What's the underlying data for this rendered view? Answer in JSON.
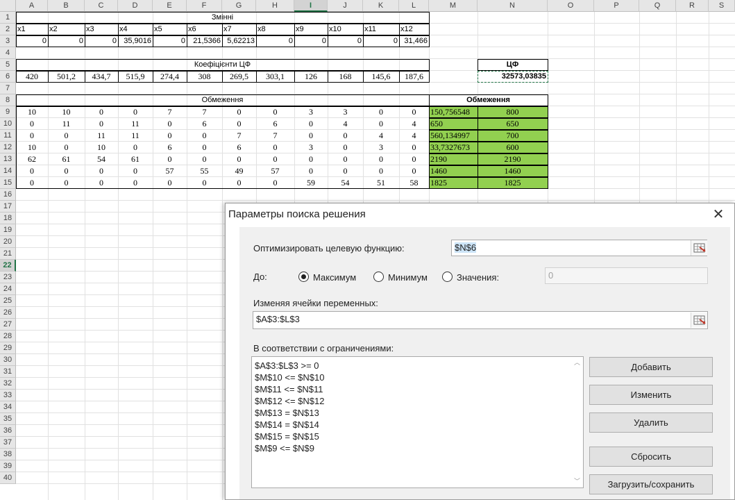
{
  "sheet": {
    "columns": [
      "A",
      "B",
      "C",
      "D",
      "E",
      "F",
      "G",
      "H",
      "I",
      "J",
      "K",
      "L",
      "M",
      "N",
      "O",
      "P",
      "Q",
      "R",
      "S"
    ],
    "rows": [
      "1",
      "2",
      "3",
      "4",
      "5",
      "6",
      "7",
      "8",
      "9",
      "10",
      "11",
      "12",
      "13",
      "14",
      "15",
      "16",
      "17",
      "18",
      "19",
      "20",
      "21",
      "22",
      "23",
      "24",
      "25",
      "26",
      "27",
      "28",
      "29",
      "30",
      "31",
      "32",
      "33",
      "34",
      "35",
      "36",
      "37",
      "38",
      "39",
      "40"
    ],
    "selected_column": "I",
    "selected_row": "22",
    "variables_title": "Змінні",
    "var_names": [
      "x1",
      "x2",
      "x3",
      "x4",
      "x5",
      "x6",
      "x7",
      "x8",
      "x9",
      "x10",
      "x11",
      "x12"
    ],
    "var_values": [
      "0",
      "0",
      "0",
      "35,9016",
      "0",
      "21,5366",
      "5,62213",
      "0",
      "0",
      "0",
      "0",
      "31,466"
    ],
    "coef_title": "Коефіцієнти ЦФ",
    "coef_values": [
      "420",
      "501,2",
      "434,7",
      "515,9",
      "274,4",
      "308",
      "269,5",
      "303,1",
      "126",
      "168",
      "145,6",
      "187,6"
    ],
    "cf_title": "ЦФ",
    "cf_value": "32573,03835",
    "constraints_title": "Обмеження",
    "constraints_title2": "Обмеження",
    "constraint_rows": [
      {
        "coefs": [
          "10",
          "10",
          "0",
          "0",
          "7",
          "7",
          "0",
          "0",
          "3",
          "3",
          "0",
          "0"
        ],
        "lhs": "150,756548",
        "rhs": "800"
      },
      {
        "coefs": [
          "0",
          "11",
          "0",
          "11",
          "0",
          "6",
          "0",
          "6",
          "0",
          "4",
          "0",
          "4"
        ],
        "lhs": "650",
        "rhs": "650"
      },
      {
        "coefs": [
          "0",
          "0",
          "11",
          "11",
          "0",
          "0",
          "7",
          "7",
          "0",
          "0",
          "4",
          "4"
        ],
        "lhs": "560,134997",
        "rhs": "700"
      },
      {
        "coefs": [
          "10",
          "0",
          "10",
          "0",
          "6",
          "0",
          "6",
          "0",
          "3",
          "0",
          "3",
          "0"
        ],
        "lhs": "33,7327673",
        "rhs": "600"
      },
      {
        "coefs": [
          "62",
          "61",
          "54",
          "61",
          "0",
          "0",
          "0",
          "0",
          "0",
          "0",
          "0",
          "0"
        ],
        "lhs": "2190",
        "rhs": "2190"
      },
      {
        "coefs": [
          "0",
          "0",
          "0",
          "0",
          "57",
          "55",
          "49",
          "57",
          "0",
          "0",
          "0",
          "0"
        ],
        "lhs": "1460",
        "rhs": "1460"
      },
      {
        "coefs": [
          "0",
          "0",
          "0",
          "0",
          "0",
          "0",
          "0",
          "0",
          "59",
          "54",
          "51",
          "58"
        ],
        "lhs": "1825",
        "rhs": "1825"
      }
    ]
  },
  "dialog": {
    "title": "Параметры поиска решения",
    "objective_label": "Оптимизировать целевую функцию:",
    "objective_value": "$N$6",
    "to_label": "До:",
    "radio_max": "Максимум",
    "radio_min": "Минимум",
    "radio_value": "Значения:",
    "selected_goal": "max",
    "value_field": "0",
    "changing_label": "Изменяя ячейки переменных:",
    "changing_value": "$A$3:$L$3",
    "constraints_label": "В соответствии с ограничениями:",
    "constraints": [
      "$A$3:$L$3 >= 0",
      "$M$10 <= $N$10",
      "$M$11 <= $N$11",
      "$M$12 <= $N$12",
      "$M$13 = $N$13",
      "$M$14 = $N$14",
      "$M$15 = $N$15",
      "$M$9 <= $N$9"
    ],
    "buttons": {
      "add": "Добавить",
      "change": "Изменить",
      "delete": "Удалить",
      "reset": "Сбросить",
      "load_save": "Загрузить/сохранить"
    },
    "close_icon": "close-icon",
    "ref_icon": "range-select-icon",
    "colors": {
      "accent": "#217346",
      "green_fill": "#92d050"
    }
  }
}
